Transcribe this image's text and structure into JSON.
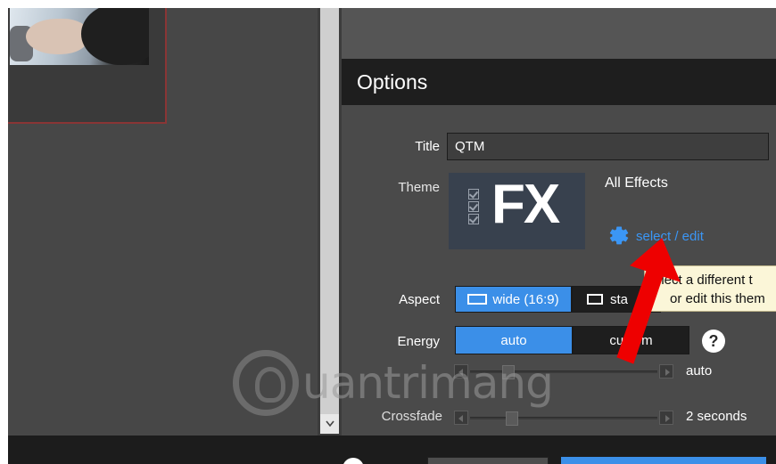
{
  "options": {
    "header": "Options",
    "title_label": "Title",
    "title_value": "QTM",
    "theme_label": "Theme",
    "theme_thumb_text": "FX",
    "theme_name": "All Effects",
    "theme_action": "select / edit",
    "aspect_label": "Aspect",
    "aspect_options": [
      {
        "label": "wide (16:9)",
        "selected": true
      },
      {
        "label": "standard",
        "visible_text": "sta",
        "selected": false
      }
    ],
    "energy_label": "Energy",
    "energy_options": [
      {
        "label": "auto",
        "selected": true
      },
      {
        "label": "custom",
        "selected": false
      }
    ],
    "energy_help": "?",
    "energy_slider_value": "auto",
    "crossfade_label": "Crossfade",
    "crossfade_value": "2 seconds"
  },
  "tooltip": {
    "line1": "elect a different t",
    "line2": "or edit this them"
  },
  "watermark": "uantrimang",
  "colors": {
    "accent": "#3b8fe8",
    "link": "#3b96f5",
    "annotation_arrow": "#ee0000",
    "tooltip_bg": "#fbf6d8"
  },
  "icons": {
    "gear": "gear-icon",
    "help": "help-icon",
    "scroll_down": "chevron-down-icon"
  }
}
